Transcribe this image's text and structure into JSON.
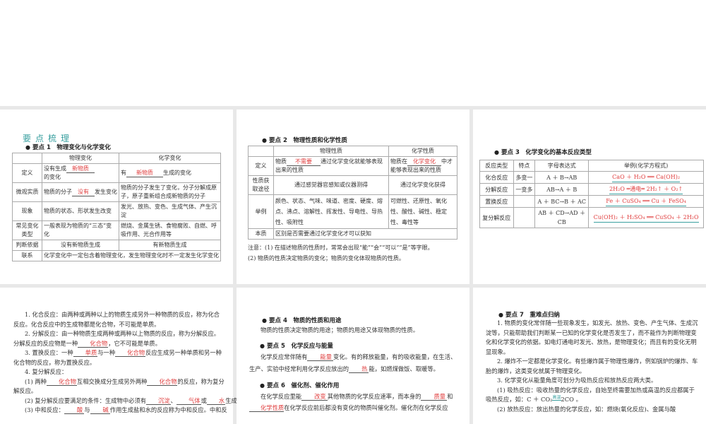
{
  "heading": "要点梳理",
  "s1": {
    "title": "要点 1　物理变化与化学变化",
    "headers": [
      "",
      "物理变化",
      "化学变化"
    ],
    "rows": [
      {
        "k": "定义",
        "a_pre": "没有生成",
        "a_fill": "新物质",
        "a_post": "的变化",
        "b_pre": "有",
        "b_fill": "新物质",
        "b_post": "生成的变化"
      },
      {
        "k": "微观实质",
        "a_pre": "物质的分子",
        "a_fill": "没有",
        "a_post": "发生变化",
        "b": "物质的分子发生了变化，分子分解成原子，原子重新组合成新物质的分子"
      },
      {
        "k": "现象",
        "a": "物质的状态、形状发生改变",
        "b": "发光、放热、变色、生成气体、产生沉淀"
      },
      {
        "k": "常见变化类型",
        "a": "一般表现为物质的“三态”变化",
        "b": "燃烧、金属生锈、食物腐败、自燃、呼吸作用、光合作用等"
      },
      {
        "k": "判断依据",
        "a": "没有新物质生成",
        "b": "有新物质生成"
      },
      {
        "k": "联系",
        "a": "化学变化中一定包含着物理变化，发生物理变化时不一定发生化学变化"
      }
    ]
  },
  "s2": {
    "title": "要点 2　物理性质和化学性质",
    "headers": [
      "",
      "物理性质",
      "化学性质"
    ],
    "rows": [
      {
        "k": "定义",
        "a_pre": "物质",
        "a_fill": "不需要",
        "a_post": "通过化学变化就能够表现出来的性质",
        "b_pre": "物质在",
        "b_fill": "化学变化",
        "b_post": "中才能够表现出来的性质"
      },
      {
        "k": "性质获取途径",
        "a": "通过感觉器官感知或仪器测得",
        "b": "通过化学变化获得"
      },
      {
        "k": "举例",
        "a": "颜色、状态、气味、味道、密度、硬度、熔点、沸点、溶解性、挥发性、导电性、导热性、吸附性",
        "b": "可燃性、还原性、氧化性、酸性、碱性、稳定性、毒性等"
      },
      {
        "k": "本质",
        "a": "区别是否需要通过化学变化才可以获知"
      }
    ],
    "notes": [
      "注意：(1) 在描述物质的性质时，常常会出现“能”“会”“可以”“是”等字眼。",
      "(2) 物质的性质决定物质的变化；物质的变化体现物质的性质。"
    ]
  },
  "s3": {
    "title": "要点 3　化学变化的基本反应类型",
    "headers": [
      "反应类型",
      "特点",
      "字母表达式",
      "举例(化学方程式)"
    ],
    "rows": [
      {
        "type": "化合反应",
        "feat": "多变一",
        "expr": "A ＋ B→AB",
        "eq": "CaO ＋ H₂O ══ Ca(OH)₂"
      },
      {
        "type": "分解反应",
        "feat": "一变多",
        "expr": "AB→A ＋ B",
        "eq": "2H₂O ═通电═ 2H₂↑ ＋ O₂↑"
      },
      {
        "type": "置换反应",
        "feat": "",
        "expr": "A ＋ BC→B ＋ AC",
        "eq": "Fe ＋ CuSO₄ ══ Cu ＋ FeSO₄"
      },
      {
        "type": "复分解反应",
        "feat": "",
        "expr": "AB ＋ CD→AD ＋ CB",
        "eq": "Cu(OH)₂ ＋ H₂SO₄ ══ CuSO₄ ＋ 2H₂O"
      }
    ]
  },
  "p4": {
    "l1": "1. 化合反应：由两种或两种以上的物质生成另外一种物质的反应，称为化合反应。化合反应中的生成物都是化合物，不可能是单质。",
    "l2a": "2. 分解反应：由一种物质生成两种或两种以上物质的反应，称为分解反应。分解反应的反应物是一种",
    "l2f": "化合物",
    "l2b": "，它不可能是单质。",
    "l3a": "3. 置换反应：一种",
    "l3f1": "单质",
    "l3b": "与一种",
    "l3f2": "化合物",
    "l3c": "反应生成另一种单质和另一种化合物的反应，称为置换反应。",
    "l4": "4. 复分解反应：",
    "l5a": "(1) 两种",
    "l5f1": "化合物",
    "l5b": "互相交换成分生成另外两种",
    "l5f2": "化合物",
    "l5c": "的反应，称为复分解反应。",
    "l6a": "(2) 复分解反应要满足的条件：生成物中必须有",
    "l6f1": "沉淀",
    "l6b": "、",
    "l6f2": "气体",
    "l6c": "或",
    "l6f3": "水",
    "l6d": "生成。",
    "l7a": "(3) 中和反应：",
    "l7f1": "酸",
    "l7b": "与",
    "l7f2": "碱",
    "l7c": "作用生成盐和水的反应称为中和反应。中和反"
  },
  "p5": {
    "t4": "要点 4　物质的性质和用途",
    "x4": "物质的性质决定物质的用途；物质的用途又体现物质的性质。",
    "t5": "要点 5　化学反应与能量",
    "x5a": "化学反应常伴随有",
    "x5f1": "能量",
    "x5b": "变化。有的释放能量，有的吸收能量，在生活、生产、实验中经常利用化学反应放出的",
    "x5f2": "热",
    "x5c": "能，如燃煤做饭、取暖等。",
    "t6": "要点 6　催化剂、催化作用",
    "x6a": "在化学反应里能",
    "x6f1": "改变",
    "x6b": "其他物质的化学反应速率，而本身的",
    "x6f2": "质量",
    "x6c": "和",
    "x6f3": "化学性质",
    "x6d": "在化学反应前后都没有变化的物质叫催化剂。催化剂在化学反应"
  },
  "p6": {
    "t7": "要点 7　重难点归纳",
    "l1": "1. 物质的变化常伴随一些现象发生，如发光、放热、变色、产生气体、生成沉淀等，只能帮助我们判断某一已知的化学变化是否发生了，而不能作为判断物理变化和化学变化的依据。如电灯通电时发光、放热，是物理变化；而且有的变化无明显现象。",
    "l2": "2. 爆炸不一定都是化学变化。有些爆炸属于物理性爆炸，例如锅炉的爆炸、车胎的爆炸，这类变化就属于物理变化。",
    "l3": "3. 化学变化从能量角度可划分为吸热反应和放热反应两大类。",
    "l4a": "(1) 吸热反应：吸收热量的化学反应，自始至终需要加热或高温的反应都属于吸热反应，如：C ＋ CO₂",
    "l4cond": "高温",
    "l4b": "2CO 。",
    "l5": "(2) 放热反应：放出热量的化学反应，如：燃烧(氧化反应)、金属与酸"
  }
}
